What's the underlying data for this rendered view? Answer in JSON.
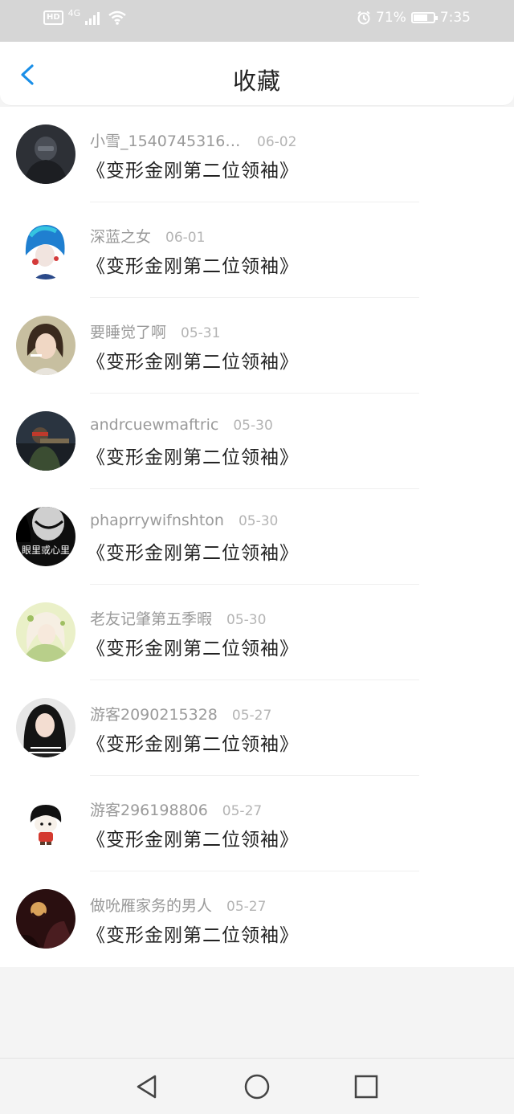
{
  "status_bar": {
    "network": "4G",
    "battery_percent": "71%",
    "battery_level": 0.71,
    "time": "7:35",
    "icons": [
      "hd-icon",
      "signal-icon",
      "wifi-icon",
      "alarm-icon",
      "battery-icon"
    ]
  },
  "header": {
    "title": "收藏",
    "back_icon": "chevron-left-icon",
    "accent": "#1a8fe8"
  },
  "favorites": [
    {
      "user": "小雪_15407453162...",
      "date": "06-02",
      "title": "《变形金刚第二位领袖》",
      "avatar_icon": "avatar-dark-soldier"
    },
    {
      "user": "深蓝之女",
      "date": "06-01",
      "title": "《变形金刚第二位领袖》",
      "avatar_icon": "avatar-blue-hair-girl"
    },
    {
      "user": "要睡觉了啊",
      "date": "05-31",
      "title": "《变形金刚第二位领袖》",
      "avatar_icon": "avatar-girl-portrait"
    },
    {
      "user": "andrcuewmaftric",
      "date": "05-30",
      "title": "《变形金刚第二位领袖》",
      "avatar_icon": "avatar-gamer"
    },
    {
      "user": "phaprrywifnshton",
      "date": "05-30",
      "title": "《变形金刚第二位领袖》",
      "avatar_icon": "avatar-dark-face",
      "avatar_text": "眼里或心里"
    },
    {
      "user": "老友记肇第五季暇",
      "date": "05-30",
      "title": "《变形金刚第二位领袖》",
      "avatar_icon": "avatar-anime-girl"
    },
    {
      "user": "游客2090215328",
      "date": "05-27",
      "title": "《变形金刚第二位领袖》",
      "avatar_icon": "avatar-girl-long-hair"
    },
    {
      "user": "游客296198806",
      "date": "05-27",
      "title": "《变形金刚第二位领袖》",
      "avatar_icon": "avatar-cartoon-kid"
    },
    {
      "user": "做吮雁家务的男人",
      "date": "05-27",
      "title": "《变形金刚第二位领袖》",
      "avatar_icon": "avatar-dark-scene"
    }
  ],
  "nav_bar": {
    "icons": [
      "back-triangle-icon",
      "home-circle-icon",
      "recents-square-icon"
    ]
  }
}
